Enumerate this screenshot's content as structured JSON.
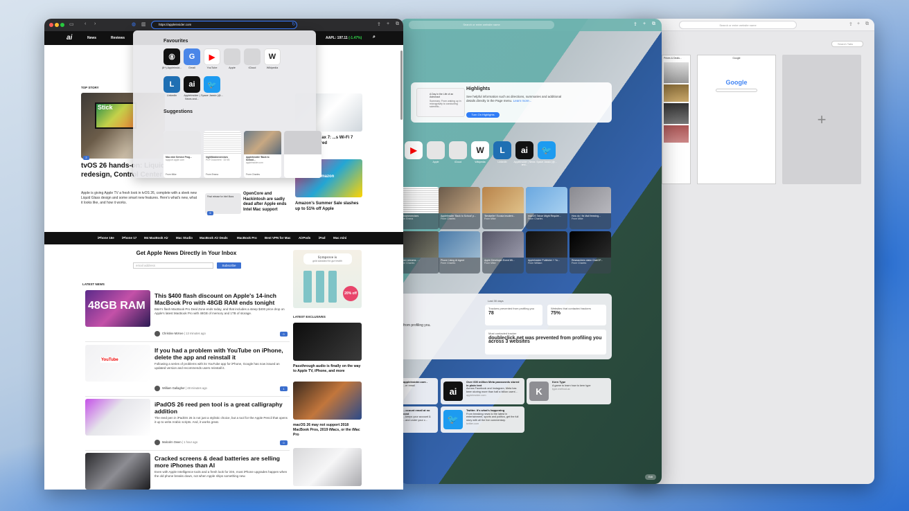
{
  "win3": {
    "address_placeholder": "Search or enter website name",
    "search_tabs_placeholder": "Search Tabs",
    "tab1_title": "Prices & Deals...",
    "tab2_title": "Google",
    "tab2_logo": "Google",
    "new_tab_glyph": "+"
  },
  "win2": {
    "address_placeholder": "Search or enter website name",
    "highlights": {
      "title": "Highlights",
      "desc": "See helpful information such as directions, summaries and additional details directly in the Page menu.",
      "learn_more": "Learn more...",
      "button": "Turn On Highlights",
      "thumb_text": "A Day in the Life of an Astronaut",
      "thumb_sub": "Summary: From waking up in microgravity to conducting scientific..."
    },
    "favourites": [
      {
        "label": "",
        "glyph": "▶",
        "bg": "#ffffff",
        "fg": "#ff0000"
      },
      {
        "label": "Apple",
        "glyph": "",
        "bg": "#e5e5e5",
        "fg": "#555555"
      },
      {
        "label": "iCloud",
        "glyph": "",
        "bg": "#e5e5e5",
        "fg": "#555555"
      },
      {
        "label": "Wikipedia",
        "glyph": "W",
        "bg": "#ffffff",
        "fg": "#222222"
      },
      {
        "label": "LinkedIn",
        "glyph": "L",
        "bg": "#1f6fb3",
        "fg": "#ffffff"
      },
      {
        "label": "AppleInsider | News and...",
        "glyph": "ai",
        "bg": "#111111",
        "fg": "#ffffff"
      },
      {
        "label": "Space Jassio (@...",
        "glyph": "🐦",
        "bg": "#1d9bf0",
        "fg": "#ffffff"
      }
    ],
    "suggestions_row1": [
      {
        "title": "...sbrainexercises",
        "from": "From Emma"
      },
      {
        "title": "AppleInsider 'Back to School' p...",
        "from": "From Charles"
      },
      {
        "title": "'Bestseller' Ecosia Insolent...",
        "from": "From Mike"
      },
      {
        "title": "macOS Tahoe Might Require...",
        "from": "From Charles"
      },
      {
        "title": "How do I fix Mail freezing...",
        "from": "From Mike"
      }
    ],
    "suggestions_row2": [
      {
        "title": "...nner streams - ...",
        "from": "From Charles"
      },
      {
        "title": "Phone Using AI Agent",
        "from": "From Charles"
      },
      {
        "title": "Apple Developer Event Wi...",
        "from": "From Mike"
      },
      {
        "title": "AppleInsider Publisher + Yo...",
        "from": "From William"
      },
      {
        "title": "Researchers claim ChatGP...",
        "from": "From Charles"
      }
    ],
    "privacy": {
      "period": "Last 30 days",
      "side_text": "from profiling you.",
      "trackers_label": "Trackers prevented from profiling you",
      "trackers_value": "78",
      "websites_label": "Websites that contacted trackers",
      "websites_value": "75%",
      "most_label": "Most contacted tracker",
      "most_value": "doubleclick.net was prevented from profiling you across 3 websites"
    },
    "reading_list": [
      {
        "title": "appleinsider.com -",
        "desc": "...er email",
        "url": "",
        "glyph": "",
        "bg": "#ffffff"
      },
      {
        "title": "Over 600 million Meta passwords stored in plain text",
        "desc": "Across Facebook and Instagram, Meta has been storing more than half a billion users'...",
        "url": "appleinsider.com",
        "glyph": "ai",
        "bg": "#111111"
      },
      {
        "title": "Kern Type",
        "desc": "A game to learn how to kern type",
        "url": "type.method.ac",
        "glyph": "K",
        "bg": "#8e8e93"
      },
      {
        "title": "...ccount email at no cost",
        "desc": "...keeps your account & ...and under your c...",
        "url": "",
        "glyph": "",
        "bg": "#ffffff"
      },
      {
        "title": "Twitter. It's what's happening",
        "desc": "From breaking news to the latest in entertainment, sports and politics, get the full story with all the live commentary.",
        "url": "twitter.com",
        "glyph": "🐦",
        "bg": "#1d9bf0"
      }
    ],
    "edit_label": "Edit"
  },
  "win1": {
    "url": "https://appleinsider.com",
    "nav": {
      "logo": "ai",
      "news": "News",
      "reviews": "Reviews",
      "stock": "AAPL: 197.11",
      "stock_change": "(-1.47%)"
    },
    "popover": {
      "favourites_heading": "Favourites",
      "suggestions_heading": "Suggestions",
      "favourites": [
        {
          "label": "(8+) Appleinsid...",
          "glyph": "⑧",
          "bg": "#111111",
          "fg": "#ffffff"
        },
        {
          "label": "Gmail",
          "glyph": "G",
          "bg": "#4a86e8",
          "fg": "#ffffff"
        },
        {
          "label": "YouTube",
          "glyph": "▶",
          "bg": "#ffffff",
          "fg": "#ff0000"
        },
        {
          "label": "Apple",
          "glyph": "",
          "bg": "#d6d6d8",
          "fg": "#555555"
        },
        {
          "label": "iCloud",
          "glyph": "",
          "bg": "#d6d6d8",
          "fg": "#555555"
        },
        {
          "label": "Wikipedia",
          "glyph": "W",
          "bg": "#ffffff",
          "fg": "#222222"
        },
        {
          "label": "LinkedIn",
          "glyph": "L",
          "bg": "#1f6fb3",
          "fg": "#ffffff"
        },
        {
          "label": "AppleInsider | News and...",
          "glyph": "ai",
          "bg": "#111111",
          "fg": "#ffffff"
        },
        {
          "label": "Space Jassio (@...",
          "glyph": "🐦",
          "bg": "#1d9bf0",
          "fg": "#ffffff"
        }
      ],
      "suggestions": [
        {
          "title": "Mac mini Service Prog...",
          "sub": "support.apple.com",
          "from": "From Mike"
        },
        {
          "title": "highfibrainexercises",
          "sub": "PDF Document · 33 KB",
          "from": "From Emma"
        },
        {
          "title": "AppleInsider 'Back to School...",
          "sub": "appleinsider.com",
          "from": "From Charles"
        },
        {
          "title": "",
          "sub": "",
          "from": ""
        }
      ]
    },
    "top_story_label": "TOP STORY",
    "top_story": {
      "title": "tvOS 26 hands-on: Liquid Glass redesign, Control Center and more",
      "desc": "Apple is giving Apple TV a fresh look in tvOS 26, complete with a sleek new Liquid Glass design and some smart new features. Here's what's new, what it looks like, and how it works.",
      "comments": "2",
      "image_text": "Stick"
    },
    "side_stories": [
      {
        "title": "...7 vs Eero Max 7: ...s Wi-Fi 7 ...ing, compared"
      },
      {
        "title": "OpenCore and Hackintosh are sadly dead after Apple ends Intel Mac support",
        "comments": "5",
        "image_text": "Final release for Intel Macs"
      },
      {
        "title": "Amazon's Summer Sale slashes up to 51% off Apple",
        "image_text": "amazon"
      }
    ],
    "categories": [
      "iPhone 16e",
      "iPhone 17",
      "M4 MacBook Air",
      "Mac Studio",
      "MacBook Air Deals",
      "MacBook Pro",
      "Best VPN for Mac",
      "AirPods",
      "iPad",
      "Mac mini"
    ],
    "newsletter": {
      "heading": "Get Apple News Directly in Your Inbox",
      "placeholder": "email address",
      "button": "Subscribe"
    },
    "latest_news_label": "LATEST NEWS",
    "latest_exclusives_label": "LATEST EXCLUSIVES",
    "articles": [
      {
        "title": "This $400 flash discount on Apple's 14-inch MacBook Pro with 48GB RAM ends tonight",
        "desc": "B&H's flash MacBook Pro Deal Zone ends today, and that includes a steep $400 price drop on Apple's latest MacBook Pro with 48GB of memory and 1TB of storage.",
        "author": "Christine McKee",
        "time": "13 minutes ago",
        "comments": "0",
        "thumb_text": "48GB RAM"
      },
      {
        "title": "If you had a problem with YouTube on iPhone, delete the app and reinstall it",
        "desc": "Following a series of problems with its YouTube app for iPhone, Google has now issued an updated version and recommends users reinstall it.",
        "author": "William Gallagher",
        "time": "48 minutes ago",
        "comments": "1",
        "thumb_text": "YouTube"
      },
      {
        "title": "iPadOS 26 reed pen tool is a great calligraphy addition",
        "desc": "The reed pen in iPadOS 26 is not just a stylistic choice, but a tool for the Apple Pencil that opens it up to write Arabic scripts. And, it works great.",
        "author": "Malcolm Owen",
        "time": "1 hour ago",
        "comments": "0",
        "thumb_text": ""
      },
      {
        "title": "Cracked screens & dead batteries are selling more iPhones than AI",
        "desc": "Even with Apple Intelligence tools and a fresh look for iOS, most iPhone upgrades happen when the old phone breaks down, not when Apple ships something new.",
        "author": "",
        "time": "",
        "comments": "",
        "thumb_text": ""
      }
    ],
    "ad": {
      "brand": "Symprove is",
      "tagline": "gold standard for gut health",
      "offer": "20% off"
    },
    "exclusives": [
      {
        "title": "Passthrough audio is finally on the way to Apple TV, iPhone, and more"
      },
      {
        "title": "macOS 26 may not support 2018 MacBook Pros, 2019 iMacs, or the iMac Pro"
      },
      {
        "title": ""
      }
    ]
  }
}
